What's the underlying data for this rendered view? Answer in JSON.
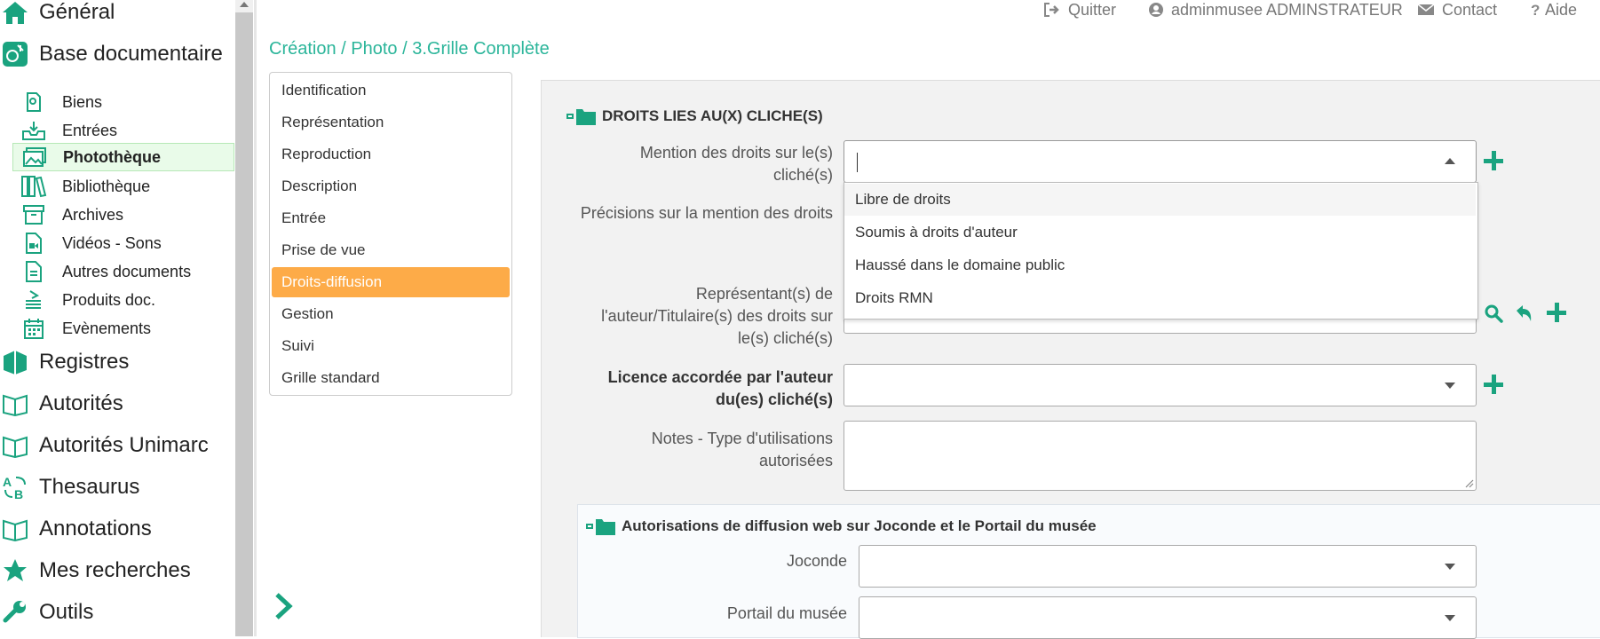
{
  "sidebar": {
    "main_top": [
      {
        "label": "Général",
        "icon": "home-icon"
      },
      {
        "label": "Base documentaire",
        "icon": "museum-doc-icon"
      }
    ],
    "sub_items": [
      {
        "label": "Biens",
        "icon": "object-icon"
      },
      {
        "label": "Entrées",
        "icon": "inbox-icon"
      },
      {
        "label": "Photothèque",
        "icon": "images-icon",
        "active": true
      },
      {
        "label": "Bibliothèque",
        "icon": "books-icon"
      },
      {
        "label": "Archives",
        "icon": "archive-box-icon"
      },
      {
        "label": "Vidéos - Sons",
        "icon": "video-file-icon"
      },
      {
        "label": "Autres documents",
        "icon": "document-icon"
      },
      {
        "label": "Produits doc.",
        "icon": "stack-doc-icon"
      },
      {
        "label": "Evènements",
        "icon": "calendar-icon"
      }
    ],
    "main_bottom": [
      {
        "label": "Registres",
        "icon": "registers-icon"
      },
      {
        "label": "Autorités",
        "icon": "open-book-icon"
      },
      {
        "label": "Autorités Unimarc",
        "icon": "open-book-icon"
      },
      {
        "label": "Thesaurus",
        "icon": "translate-icon"
      },
      {
        "label": "Annotations",
        "icon": "open-book-icon"
      },
      {
        "label": "Mes recherches",
        "icon": "star-icon"
      },
      {
        "label": "Outils",
        "icon": "wrench-icon"
      }
    ]
  },
  "topbar": {
    "quit": "Quitter",
    "user": "adminmusee ADMINSTRATEUR",
    "contact": "Contact",
    "help": "Aide"
  },
  "breadcrumb": "Création / Photo / 3.Grille Complète",
  "tabs": [
    {
      "label": "Identification"
    },
    {
      "label": "Représentation"
    },
    {
      "label": "Reproduction"
    },
    {
      "label": "Description"
    },
    {
      "label": "Entrée"
    },
    {
      "label": "Prise de vue"
    },
    {
      "label": "Droits-diffusion",
      "active": true
    },
    {
      "label": "Gestion"
    },
    {
      "label": "Suivi"
    },
    {
      "label": "Grille standard"
    }
  ],
  "form": {
    "section_title": "DROITS LIES AU(X) CLICHE(S)",
    "mention_label_1": "Mention des droits sur le(s)",
    "mention_label_2": "cliché(s)",
    "mention_value": "",
    "precisions_label": "Précisions sur la mention des droits",
    "representant_label_1": "Représentant(s) de",
    "representant_label_2": "l'auteur/Titulaire(s) des droits sur",
    "representant_label_3": "le(s) cliché(s)",
    "licence_label_1": "Licence accordée par l'auteur",
    "licence_label_2": "du(es) cliché(s)",
    "notes_label_1": "Notes - Type d'utilisations",
    "notes_label_2": "autorisées",
    "dropdown_options": [
      "Libre de droits",
      "Soumis à droits d'auteur",
      "Haussé dans le domaine public",
      "Droits RMN"
    ],
    "web_section_title": "Autorisations de diffusion web sur Joconde et le Portail du musée",
    "joconde_label": "Joconde",
    "portail_label": "Portail du musée"
  },
  "colors": {
    "accent": "#1aa37f",
    "active_tab": "#fdab48",
    "breadcrumb": "#2bb59a"
  }
}
